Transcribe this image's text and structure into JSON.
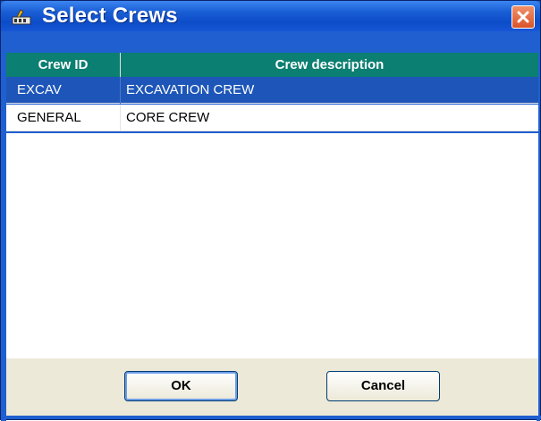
{
  "window": {
    "title": "Select Crews",
    "close_icon": "close-icon",
    "app_icon": "crew-app-icon"
  },
  "table": {
    "columns": [
      "Crew ID",
      "Crew description"
    ],
    "rows": [
      {
        "id": "EXCAV",
        "description": "EXCAVATION CREW",
        "selected": true
      },
      {
        "id": "GENERAL",
        "description": "CORE CREW",
        "selected": false
      }
    ]
  },
  "buttons": {
    "ok_label": "OK",
    "cancel_label": "Cancel"
  },
  "colors": {
    "title_bar": "#1a5fd6",
    "header": "#0b7f72",
    "selection": "#1d56b8",
    "close_button": "#d9542a"
  }
}
